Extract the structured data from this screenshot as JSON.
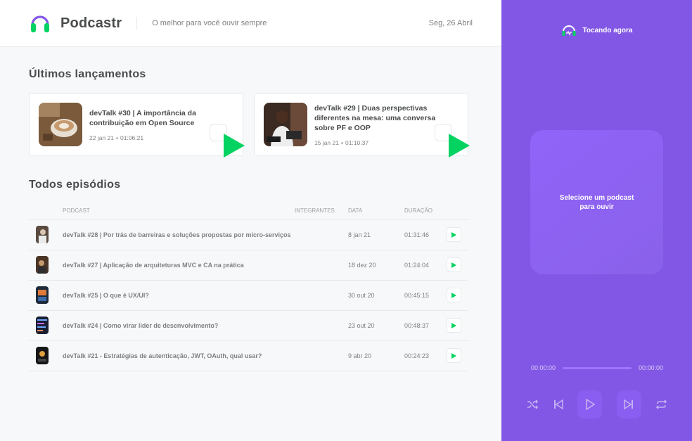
{
  "header": {
    "brand": "Podcastr",
    "tagline": "O melhor para você ouvir sempre",
    "date": "Seg, 26 Abril"
  },
  "latest": {
    "title": "Últimos lançamentos",
    "episodes": [
      {
        "title": "devTalk #30 | A importância da contribuição em Open Source",
        "date": "22 jan 21",
        "duration": "01:06:21"
      },
      {
        "title": "devTalk #29 | Duas perspectivas diferentes na mesa: uma conversa sobre PF e OOP",
        "date": "15 jan 21",
        "duration": "01:10:37"
      }
    ]
  },
  "all": {
    "title": "Todos episódios",
    "columns": {
      "podcast": "Podcast",
      "members": "Integrantes",
      "date": "Data",
      "duration": "Duração"
    },
    "episodes": [
      {
        "title": "devTalk #28 | Por trás de barreiras e soluções propostas por micro-serviços",
        "members": "",
        "date": "8 jan 21",
        "duration": "01:31:46"
      },
      {
        "title": "devTalk #27 | Aplicação de arquiteturas MVC e CA na prática",
        "members": "",
        "date": "18 dez 20",
        "duration": "01:24:04"
      },
      {
        "title": "devTalk #25 | O que é UX/UI?",
        "members": "",
        "date": "30 out 20",
        "duration": "00:45:15"
      },
      {
        "title": "devTalk #24 | Como virar líder de desenvolvimento?",
        "members": "",
        "date": "23 out 20",
        "duration": "00:48:37"
      },
      {
        "title": "devTalk #21 - Estratégias de autenticação, JWT, OAuth, qual usar?",
        "members": "",
        "date": "9 abr 20",
        "duration": "00:24:23"
      }
    ]
  },
  "player": {
    "header": "Tocando agora",
    "empty": "Selecione um podcast para ouvir",
    "current_time": "00:00:00",
    "total_time": "00:00:00",
    "progress": 0,
    "controls": [
      "shuffle-icon",
      "previous-icon",
      "play-icon",
      "next-icon",
      "repeat-icon"
    ]
  },
  "colors": {
    "accent": "#8257E5",
    "play_green": "#04D361",
    "text": "#494D4B"
  }
}
